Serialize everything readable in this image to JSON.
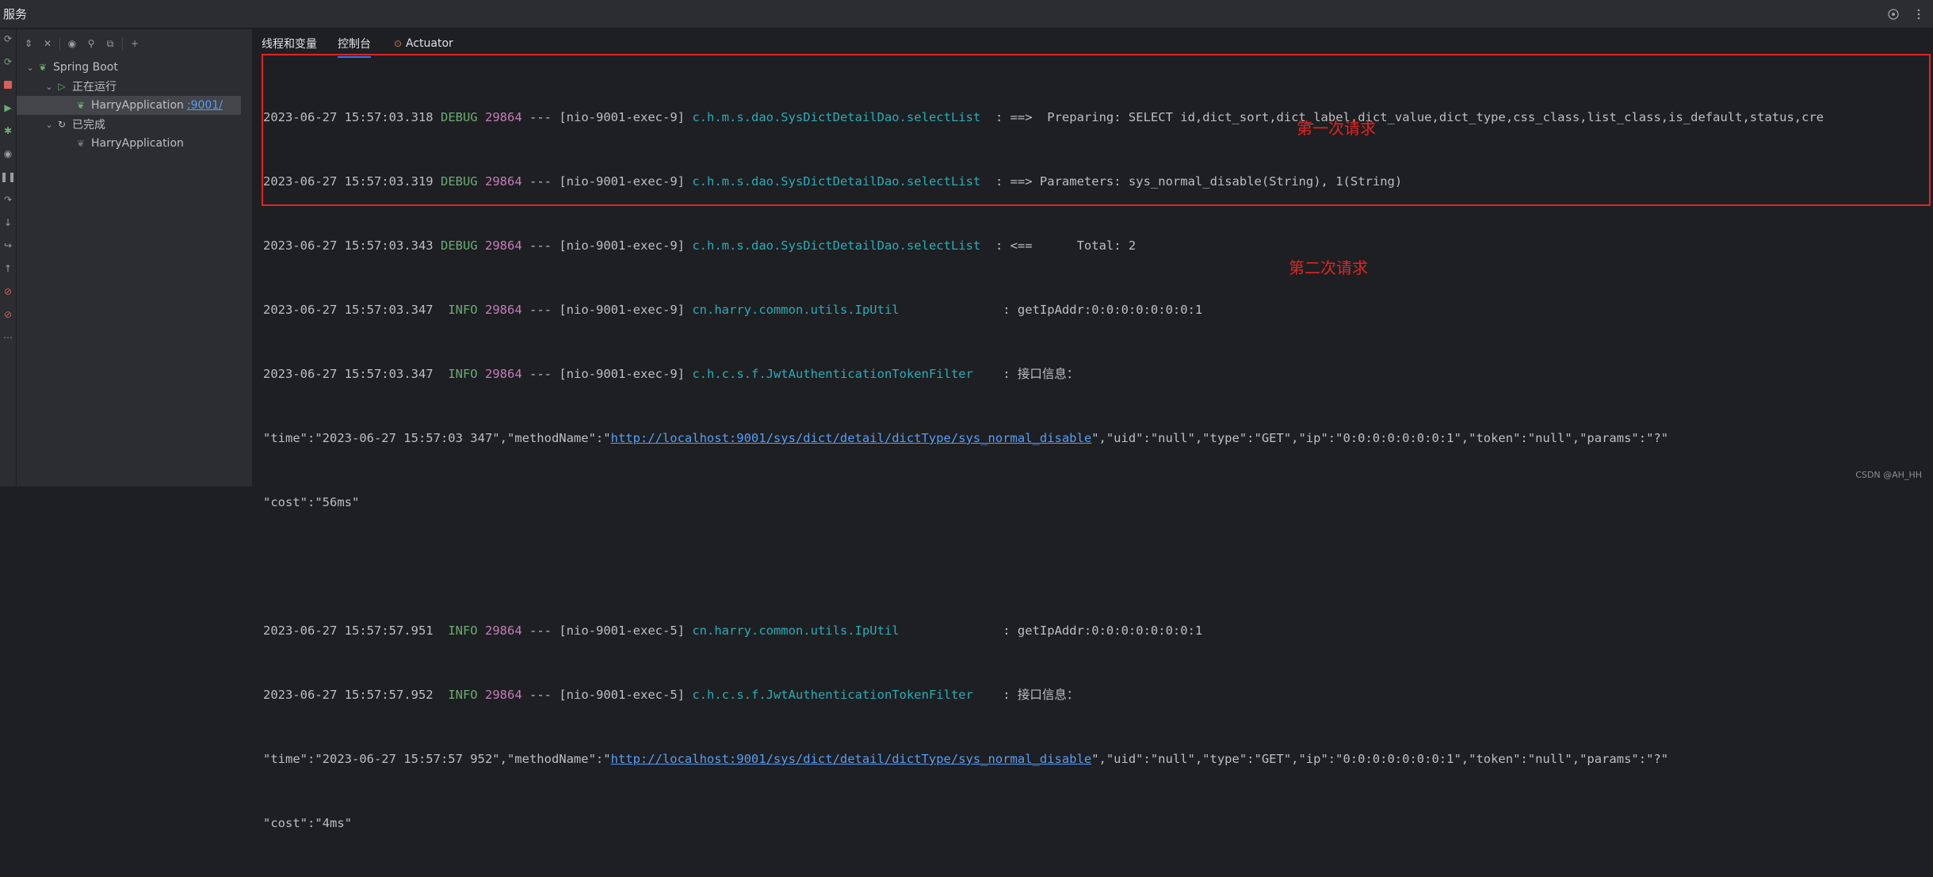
{
  "topbar": {
    "title": "服务"
  },
  "tree": {
    "root": "Spring Boot",
    "running_group": "正在运行",
    "running_app": "HarryApplication",
    "running_port": ":9001/",
    "done_group": "已完成",
    "done_app": "HarryApplication"
  },
  "tabs": [
    {
      "label": "线程和变量"
    },
    {
      "label": "控制台"
    },
    {
      "label": "Actuator"
    }
  ],
  "log": [
    {
      "ts": "2023-06-27 15:57:03.318",
      "level": "DEBUG",
      "pid": "29864",
      "thread": "--- [nio-9001-exec-9]",
      "logger": "c.h.m.s.dao.SysDictDetailDao.selectList ",
      "msg": " : ==>  Preparing: SELECT id,dict_sort,dict_label,dict_value,dict_type,css_class,list_class,is_default,status,cre"
    },
    {
      "ts": "2023-06-27 15:57:03.319",
      "level": "DEBUG",
      "pid": "29864",
      "thread": "--- [nio-9001-exec-9]",
      "logger": "c.h.m.s.dao.SysDictDetailDao.selectList ",
      "msg": " : ==> Parameters: sys_normal_disable(String), 1(String)"
    },
    {
      "ts": "2023-06-27 15:57:03.343",
      "level": "DEBUG",
      "pid": "29864",
      "thread": "--- [nio-9001-exec-9]",
      "logger": "c.h.m.s.dao.SysDictDetailDao.selectList ",
      "msg": " : <==      Total: 2"
    },
    {
      "ts": "2023-06-27 15:57:03.347",
      "level": " INFO",
      "pid": "29864",
      "thread": "--- [nio-9001-exec-9]",
      "logger": "cn.harry.common.utils.IpUtil             ",
      "msg": " : getIpAddr:0:0:0:0:0:0:0:1"
    },
    {
      "ts": "2023-06-27 15:57:03.347",
      "level": " INFO",
      "pid": "29864",
      "thread": "--- [nio-9001-exec-9]",
      "logger": "c.h.c.s.f.JwtAuthenticationTokenFilter   ",
      "msg": " : 接口信息："
    },
    {
      "pre": "\"time\":\"2023-06-27 15:57:03 347\",\"methodName\":\"",
      "url": "http://localhost:9001/sys/dict/detail/dictType/sys_normal_disable",
      "post": "\",\"uid\":\"null\",\"type\":\"GET\",\"ip\":\"0:0:0:0:0:0:0:1\",\"token\":\"null\",\"params\":\"?\""
    },
    {
      "plain": "\"cost\":\"56ms\""
    },
    {
      "blank": true
    },
    {
      "ts": "2023-06-27 15:57:57.951",
      "level": " INFO",
      "pid": "29864",
      "thread": "--- [nio-9001-exec-5]",
      "logger": "cn.harry.common.utils.IpUtil             ",
      "msg": " : getIpAddr:0:0:0:0:0:0:0:1"
    },
    {
      "ts": "2023-06-27 15:57:57.952",
      "level": " INFO",
      "pid": "29864",
      "thread": "--- [nio-9001-exec-5]",
      "logger": "c.h.c.s.f.JwtAuthenticationTokenFilter   ",
      "msg": " : 接口信息："
    },
    {
      "pre": "\"time\":\"2023-06-27 15:57:57 952\",\"methodName\":\"",
      "url": "http://localhost:9001/sys/dict/detail/dictType/sys_normal_disable",
      "post": "\",\"uid\":\"null\",\"type\":\"GET\",\"ip\":\"0:0:0:0:0:0:0:1\",\"token\":\"null\",\"params\":\"?\""
    },
    {
      "plain": "\"cost\":\"4ms\""
    }
  ],
  "annotations": {
    "first": "第一次请求",
    "second": "第二次请求"
  },
  "watermark": "CSDN @AH_HH",
  "colors": {
    "highlight_box": "#e02424",
    "accent": "#3574f0"
  }
}
